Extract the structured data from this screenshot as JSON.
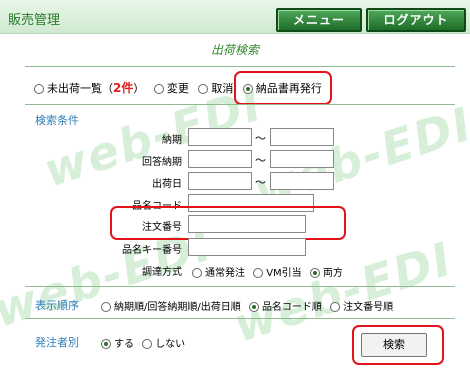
{
  "app": {
    "title": "販売管理"
  },
  "nav": {
    "menu_label": "メニュー",
    "logout_label": "ログアウト"
  },
  "page": {
    "subtitle": "出荷検索"
  },
  "modes": {
    "items": [
      "未出荷一覧（",
      "変更",
      "取消",
      "納品書再発行"
    ],
    "count": "2件",
    "count_suffix": "）",
    "selected": "納品書再発行"
  },
  "search": {
    "section_label": "検索条件",
    "fields": {
      "delivery_date": "納期",
      "answer_date": "回答納期",
      "ship_date": "出荷日",
      "product_code": "品名コード",
      "order_number": "注文番号",
      "product_key": "品名キー番号",
      "procurement": "調達方式"
    },
    "range_sep": "～",
    "procurement_options": [
      "通常発注",
      "VM引当",
      "両方"
    ],
    "procurement_selected": "両方"
  },
  "sort": {
    "label": "表示順序",
    "options": [
      "納期順/回答納期順/出荷日順",
      "品名コード順",
      "注文番号順"
    ],
    "selected": "品名コード順"
  },
  "orderer": {
    "label": "発注者別",
    "options": [
      "する",
      "しない"
    ],
    "selected": "する"
  },
  "actions": {
    "search_label": "検索"
  },
  "watermark": {
    "text": "web-EDI"
  },
  "colors": {
    "accent_green": "#2a7a2a",
    "label_blue": "#2f7fb7",
    "highlight_red": "#e2141a",
    "count_red": "#dd2222"
  }
}
